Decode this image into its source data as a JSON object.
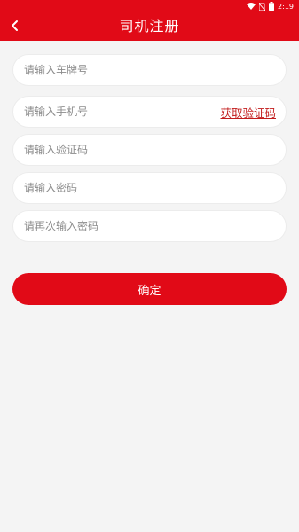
{
  "status_bar": {
    "time": "2:19",
    "icons": [
      "wifi-icon",
      "no-sim-icon",
      "battery-icon"
    ]
  },
  "app_bar": {
    "title": "司机注册",
    "back_icon": "chevron-left-icon"
  },
  "form": {
    "plate_placeholder": "请输入车牌号",
    "phone_placeholder": "请输入手机号",
    "get_code_label": "获取验证码",
    "code_placeholder": "请输入验证码",
    "password_placeholder": "请输入密码",
    "confirm_password_placeholder": "请再次输入密码",
    "submit_label": "确定"
  },
  "colors": {
    "brand": "#e10a17",
    "link": "#c21d1d",
    "background": "#f4f4f4"
  }
}
